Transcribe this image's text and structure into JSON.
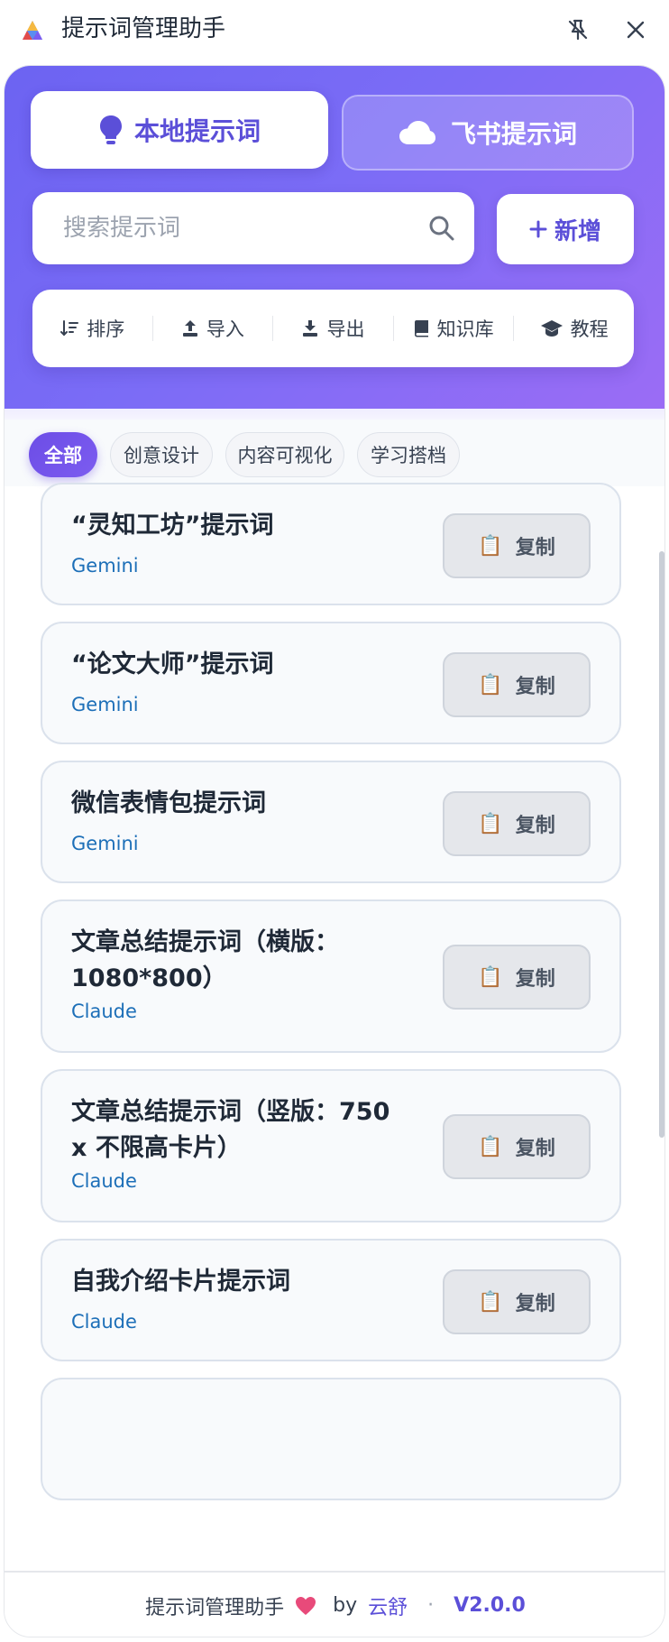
{
  "window": {
    "title": "提示词管理助手"
  },
  "tabs": {
    "local": "本地提示词",
    "cloud": "飞书提示词"
  },
  "search": {
    "placeholder": "搜索提示词"
  },
  "add_label": "新增",
  "toolbar": {
    "sort": "排序",
    "import": "导入",
    "export": "导出",
    "knowledge": "知识库",
    "tutorial": "教程"
  },
  "categories": [
    "全部",
    "创意设计",
    "内容可视化",
    "学习搭档"
  ],
  "copy_label": "复制",
  "prompts": [
    {
      "title": "“灵知工坊”提示词",
      "model": "Gemini"
    },
    {
      "title": "“论文大师”提示词",
      "model": "Gemini"
    },
    {
      "title": "微信表情包提示词",
      "model": "Gemini"
    },
    {
      "title": "文章总结提示词（横版：1080*800）",
      "model": "Claude"
    },
    {
      "title": "文章总结提示词（竖版：750 x 不限高卡片）",
      "model": "Claude"
    },
    {
      "title": "自我介绍卡片提示词",
      "model": "Claude"
    }
  ],
  "footer": {
    "name": "提示词管理助手",
    "by": "by",
    "author": "云舒",
    "separator": "·",
    "version": "V2.0.0"
  },
  "colors": {
    "accent": "#5b4fd8",
    "hero_start": "#6c63f2",
    "hero_end": "#9b6cf5",
    "model_link": "#1d6fb8"
  }
}
